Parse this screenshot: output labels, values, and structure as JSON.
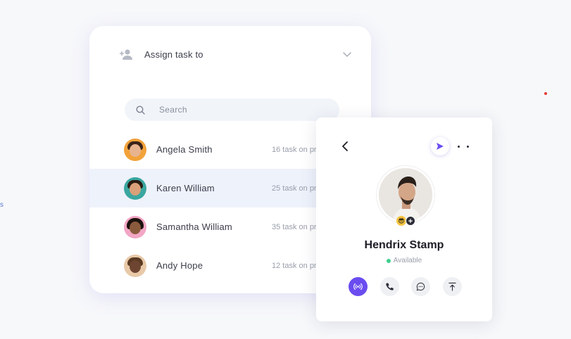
{
  "assign": {
    "title": "Assign task to",
    "search_placeholder": "Search",
    "people": [
      {
        "name": "Angela Smith",
        "tasks": "16 task on pr"
      },
      {
        "name": "Karen William",
        "tasks": "25 task on pr"
      },
      {
        "name": "Samantha William",
        "tasks": "35 task on pr"
      },
      {
        "name": "Andy Hope",
        "tasks": "12 task on pr"
      }
    ]
  },
  "profile": {
    "name": "Hendrix Stamp",
    "status": "Available",
    "badge_emoji": "😎",
    "badge_plus": "+"
  },
  "edge_mark": "s",
  "colors": {
    "accent": "#6a4cf0",
    "online": "#3ecf8e"
  }
}
